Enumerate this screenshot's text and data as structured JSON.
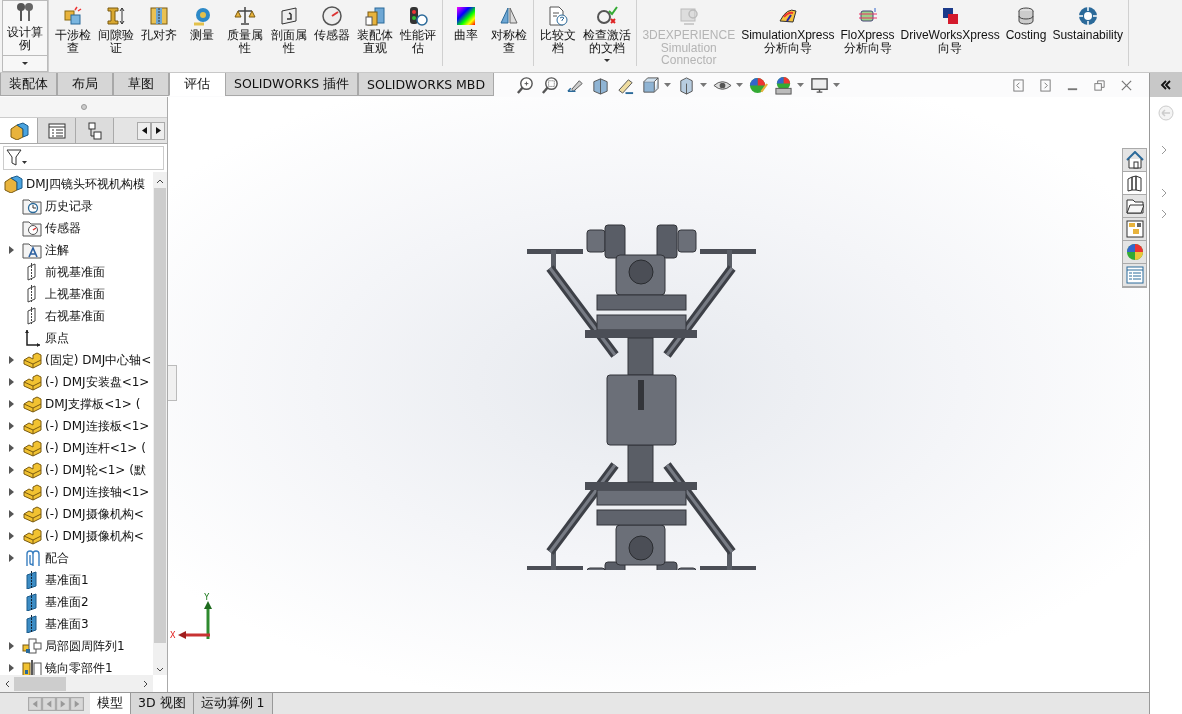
{
  "design_study": {
    "label": "设计算例"
  },
  "toolbar": {
    "groups": [
      {
        "items": [
          {
            "kind": "interference",
            "label": "干涉检查",
            "disabled": false,
            "dropdown": false
          },
          {
            "kind": "clearance",
            "label": "间隙验证",
            "disabled": false,
            "dropdown": false
          },
          {
            "kind": "hole",
            "label": "孔对齐",
            "disabled": false,
            "dropdown": false
          },
          {
            "kind": "measure",
            "label": "测量",
            "disabled": false,
            "dropdown": false
          },
          {
            "kind": "mass",
            "label": "质量属性",
            "disabled": false,
            "dropdown": false
          },
          {
            "kind": "section",
            "label": "剖面属性",
            "disabled": false,
            "dropdown": false
          },
          {
            "kind": "sensor",
            "label": "传感器",
            "disabled": false,
            "dropdown": false
          },
          {
            "kind": "assembly",
            "label": "装配体直观",
            "disabled": false,
            "dropdown": false
          },
          {
            "kind": "performance",
            "label": "性能评估",
            "disabled": false,
            "dropdown": false
          }
        ]
      },
      {
        "items": [
          {
            "kind": "curvature",
            "label": "曲率",
            "disabled": false,
            "dropdown": false
          },
          {
            "kind": "symmetry",
            "label": "对称检查",
            "disabled": false,
            "dropdown": false
          }
        ]
      },
      {
        "items": [
          {
            "kind": "compare",
            "label": "比较文档",
            "disabled": false,
            "dropdown": false
          },
          {
            "kind": "check",
            "label": "检查激活的文档",
            "disabled": false,
            "dropdown": true
          }
        ]
      },
      {
        "items": [
          {
            "kind": "connector",
            "label": "3DEXPERIENCE Simulation Connector",
            "disabled": true,
            "dropdown": false
          },
          {
            "kind": "simulation",
            "label": "SimulationXpress 分析向导",
            "disabled": false,
            "dropdown": false
          },
          {
            "kind": "flow",
            "label": "FloXpress 分析向导",
            "disabled": false,
            "dropdown": false
          },
          {
            "kind": "driveworks",
            "label": "DriveWorksXpress 向导",
            "disabled": false,
            "dropdown": false
          },
          {
            "kind": "costing",
            "label": "Costing",
            "disabled": false,
            "dropdown": false
          },
          {
            "kind": "sustainability",
            "label": "Sustainability",
            "disabled": false,
            "dropdown": false
          }
        ]
      }
    ]
  },
  "command_tabs": [
    {
      "label": "装配体",
      "selected": false
    },
    {
      "label": "布局",
      "selected": false
    },
    {
      "label": "草图",
      "selected": false
    },
    {
      "label": "评估",
      "selected": true
    },
    {
      "label": "SOLIDWORKS 插件",
      "selected": false
    },
    {
      "label": "SOLIDWORKS MBD",
      "selected": false
    }
  ],
  "panel_tabs": [
    {
      "kind": "feature",
      "selected": true
    },
    {
      "kind": "property",
      "selected": false
    },
    {
      "kind": "config",
      "selected": false
    }
  ],
  "tree": {
    "label": "DMJ四镜头环视机构模",
    "children": [
      {
        "kind": "history",
        "label": "历史记录",
        "expandable": false
      },
      {
        "kind": "sensors",
        "label": "传感器",
        "expandable": false
      },
      {
        "kind": "annotations",
        "label": "注解",
        "expandable": true
      },
      {
        "kind": "plane",
        "label": "前视基准面",
        "expandable": false
      },
      {
        "kind": "plane",
        "label": "上视基准面",
        "expandable": false
      },
      {
        "kind": "plane",
        "label": "右视基准面",
        "expandable": false
      },
      {
        "kind": "origin",
        "label": "原点",
        "expandable": false
      },
      {
        "kind": "part",
        "label": "(固定) DMJ中心轴<",
        "expandable": true
      },
      {
        "kind": "part",
        "label": "(-) DMJ安装盘<1>",
        "expandable": true
      },
      {
        "kind": "part",
        "label": "DMJ支撑板<1> (",
        "expandable": true
      },
      {
        "kind": "part",
        "label": "(-) DMJ连接板<1>",
        "expandable": true
      },
      {
        "kind": "part",
        "label": "(-) DMJ连杆<1> (",
        "expandable": true
      },
      {
        "kind": "part",
        "label": "(-) DMJ轮<1> (默",
        "expandable": true
      },
      {
        "kind": "part",
        "label": "(-) DMJ连接轴<1>",
        "expandable": true
      },
      {
        "kind": "part",
        "label": "(-) DMJ摄像机构<",
        "expandable": true
      },
      {
        "kind": "part",
        "label": "(-) DMJ摄像机构<",
        "expandable": true
      },
      {
        "kind": "mates",
        "label": "配合",
        "expandable": true
      },
      {
        "kind": "refplane",
        "label": "基准面1",
        "expandable": false
      },
      {
        "kind": "refplane",
        "label": "基准面2",
        "expandable": false
      },
      {
        "kind": "refplane",
        "label": "基准面3",
        "expandable": false
      },
      {
        "kind": "pattern",
        "label": "局部圆周阵列1",
        "expandable": true
      },
      {
        "kind": "mirror",
        "label": "镜向零部件1",
        "expandable": true
      }
    ]
  },
  "triad": {
    "x": "X",
    "y": "Y"
  },
  "task_pane_tabs": [
    {
      "kind": "home",
      "selected": false
    },
    {
      "kind": "library",
      "selected": true
    },
    {
      "kind": "folder",
      "selected": false
    },
    {
      "kind": "palette",
      "selected": false
    },
    {
      "kind": "appearance",
      "selected": false
    },
    {
      "kind": "properties",
      "selected": false
    }
  ],
  "bottom_tabs": [
    {
      "label": "模型",
      "selected": true
    },
    {
      "label": "3D 视图",
      "selected": false
    },
    {
      "label": "运动算例 1",
      "selected": false
    }
  ]
}
